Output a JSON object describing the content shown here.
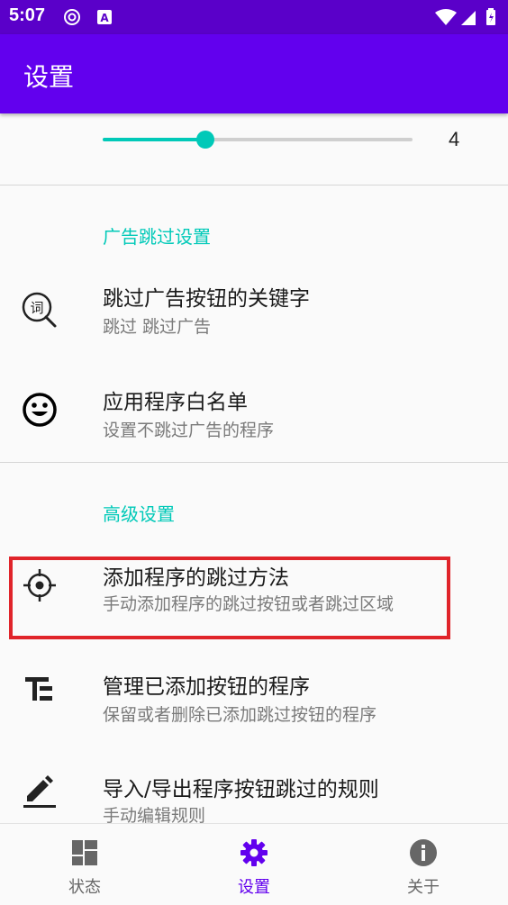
{
  "status_bar": {
    "time": "5:07"
  },
  "app_bar": {
    "title": "设置"
  },
  "slider": {
    "value_label": "4",
    "fraction": 0.33
  },
  "sections": {
    "ads": {
      "header": "广告跳过设置",
      "items": [
        {
          "title": "跳过广告按钮的关键字",
          "summary": "跳过 跳过广告",
          "icon": "keyword-search-icon"
        },
        {
          "title": "应用程序白名单",
          "summary": "设置不跳过广告的程序",
          "icon": "smiley-icon"
        }
      ]
    },
    "advanced": {
      "header": "高级设置",
      "items": [
        {
          "title": "添加程序的跳过方法",
          "summary": "手动添加程序的跳过按钮或者跳过区域",
          "icon": "crosshair-icon"
        },
        {
          "title": "管理已添加按钮的程序",
          "summary": "保留或者删除已添加跳过按钮的程序",
          "icon": "list-tree-icon"
        },
        {
          "title": "导入/导出程序按钮跳过的规则",
          "summary": "手动编辑规则",
          "icon": "edit-pencil-icon"
        }
      ]
    }
  },
  "bottom_nav": {
    "items": [
      {
        "label": "状态",
        "icon": "dashboard-icon"
      },
      {
        "label": "设置",
        "icon": "gear-icon"
      },
      {
        "label": "关于",
        "icon": "info-icon"
      }
    ],
    "active_index": 1
  },
  "colors": {
    "primary": "#6200ee",
    "status_bar": "#5a00c9",
    "accent": "#00c9b8",
    "highlight": "#e0242a"
  }
}
